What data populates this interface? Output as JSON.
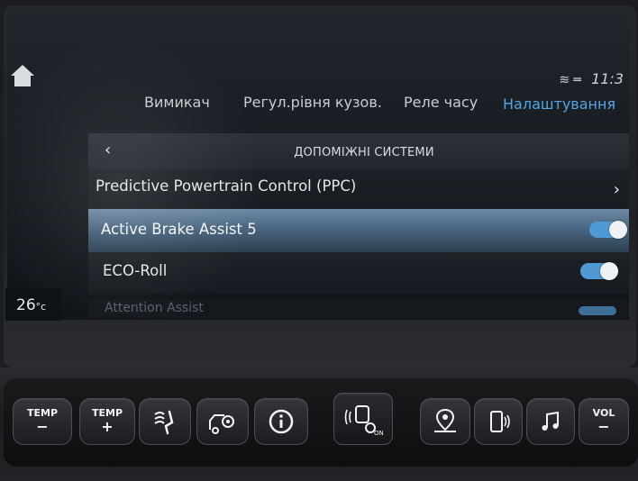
{
  "status": {
    "time": "11:3"
  },
  "tabs": [
    {
      "label": "Вимикач",
      "active": false
    },
    {
      "label": "Регул.рівня кузов.",
      "active": false
    },
    {
      "label": "Реле часу",
      "active": false
    },
    {
      "label": "Налаштування",
      "active": true
    }
  ],
  "section": {
    "title": "ДОПОМІЖНІ СИСТЕМИ"
  },
  "items": [
    {
      "label": "Predictive Powertrain Control (PPC)",
      "control": "chevron"
    },
    {
      "label": "Active Brake Assist 5",
      "control": "toggle",
      "on": true
    },
    {
      "label": "ECO-Roll",
      "control": "toggle",
      "on": true
    },
    {
      "label": "Attention Assist",
      "control": "toggle",
      "on": true
    }
  ],
  "climate": {
    "temperature": "26",
    "unit": "°c"
  },
  "buttons": {
    "temp_minus": {
      "line1": "TEMP",
      "line2": "−"
    },
    "temp_plus": {
      "line1": "TEMP",
      "line2": "+"
    },
    "vol": {
      "line1": "VOL",
      "line2": "−"
    },
    "on_label": "ON"
  },
  "colors": {
    "accent": "#52a6e6",
    "toggle": "#4f9ad4",
    "highlight_row": "#4a6680"
  },
  "icons": [
    "home-icon",
    "wifi-icon",
    "chevron-left-icon",
    "chevron-right-icon",
    "seat-airflow-icon",
    "vehicle-settings-icon",
    "info-icon",
    "driver-assist-icon",
    "navigation-icon",
    "phone-icon",
    "music-icon"
  ]
}
